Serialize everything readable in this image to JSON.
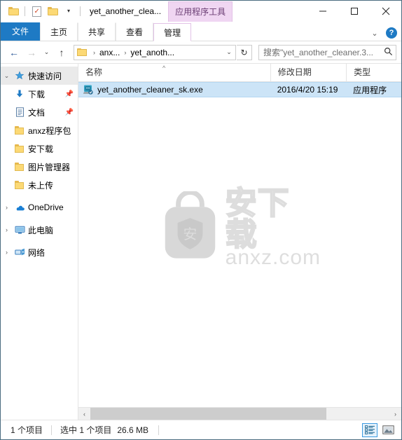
{
  "window": {
    "title": "yet_another_clea...",
    "contextual_tab": "应用程序工具",
    "minimize_label": "最小化",
    "maximize_label": "最大化",
    "close_label": "关闭"
  },
  "quick_access_toolbar": {
    "items": [
      {
        "name": "properties-icon",
        "label": "属性"
      },
      {
        "name": "new-folder-icon",
        "label": "新建文件夹"
      },
      {
        "name": "customize-caret-icon",
        "label": "自定义快速访问工具栏"
      }
    ]
  },
  "ribbon": {
    "tabs": [
      {
        "label": "文件",
        "selected": true
      },
      {
        "label": "主页",
        "selected": false
      },
      {
        "label": "共享",
        "selected": false
      },
      {
        "label": "查看",
        "selected": false
      },
      {
        "label": "管理",
        "selected": false,
        "contextual": true
      }
    ],
    "expand_icon": "chevron-down-icon",
    "help_label": "?"
  },
  "navigation": {
    "back_label": "←",
    "forward_label": "→",
    "recent_label": "⌄",
    "up_label": "↑",
    "breadcrumbs": [
      "anx...",
      "yet_anoth..."
    ],
    "separator": "›",
    "dropdown_label": "⌄",
    "refresh_label": "↻"
  },
  "search": {
    "placeholder": "搜索\"yet_another_cleaner.3...",
    "icon": "search-icon"
  },
  "sidebar": {
    "items": [
      {
        "label": "快速访问",
        "icon": "pin-star-icon",
        "expander": "⌄",
        "selected": true,
        "indent": false,
        "pinned": false
      },
      {
        "label": "下载",
        "icon": "download-icon",
        "expander": "",
        "selected": false,
        "indent": true,
        "pinned": true
      },
      {
        "label": "文档",
        "icon": "document-icon",
        "expander": "",
        "selected": false,
        "indent": true,
        "pinned": true
      },
      {
        "label": "anxz程序包",
        "icon": "folder-icon",
        "expander": "",
        "selected": false,
        "indent": true,
        "pinned": false
      },
      {
        "label": "安下载",
        "icon": "folder-icon",
        "expander": "",
        "selected": false,
        "indent": true,
        "pinned": false
      },
      {
        "label": "图片管理器",
        "icon": "folder-icon",
        "expander": "",
        "selected": false,
        "indent": true,
        "pinned": false
      },
      {
        "label": "未上传",
        "icon": "folder-icon",
        "expander": "",
        "selected": false,
        "indent": true,
        "pinned": false
      },
      {
        "label": "OneDrive",
        "icon": "cloud-icon",
        "expander": "›",
        "selected": false,
        "indent": false,
        "pinned": false
      },
      {
        "label": "此电脑",
        "icon": "computer-icon",
        "expander": "›",
        "selected": false,
        "indent": false,
        "pinned": false
      },
      {
        "label": "网络",
        "icon": "network-icon",
        "expander": "›",
        "selected": false,
        "indent": false,
        "pinned": false
      }
    ]
  },
  "filelist": {
    "columns": [
      {
        "key": "name",
        "label": "名称"
      },
      {
        "key": "date",
        "label": "修改日期"
      },
      {
        "key": "type",
        "label": "类型"
      }
    ],
    "sort_indicator": "^",
    "rows": [
      {
        "name": "yet_another_cleaner_sk.exe",
        "date": "2016/4/20 15:19",
        "type": "应用程序",
        "icon": "application-exe-icon",
        "selected": true
      }
    ]
  },
  "watermark": {
    "shield_char": "安",
    "cn_text": "安下载",
    "url_text": "anxz.com"
  },
  "scrollbar": {
    "left_arrow": "‹",
    "right_arrow": "›"
  },
  "statusbar": {
    "item_count": "1 个项目",
    "selection": "选中 1 个项目",
    "size": "26.6 MB",
    "views": [
      {
        "name": "details-view-button",
        "label": "详细信息",
        "active": true
      },
      {
        "name": "large-icons-view-button",
        "label": "大图标",
        "active": false
      }
    ]
  },
  "colors": {
    "accent": "#1e7ac4",
    "selection": "#cce4f7",
    "contextual_tab": "#f0d6f2"
  }
}
